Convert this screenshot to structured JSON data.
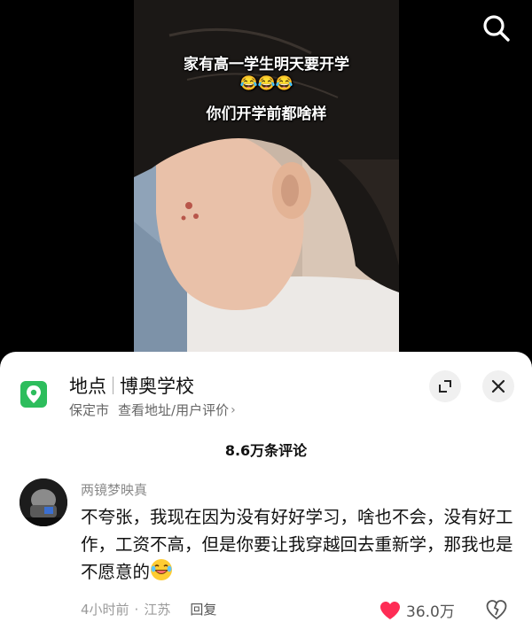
{
  "video": {
    "caption_line1": "家有高一学生明天要开学",
    "caption_line2": "😂😂😂",
    "caption_line3": "你们开学前都啥样"
  },
  "header": {
    "search_icon": "search-icon"
  },
  "location": {
    "label": "地点",
    "name": "博奥学校",
    "city": "保定市",
    "link": "查看地址/用户评价",
    "chevron": "›",
    "icon": "location-pin-icon",
    "accent": "#2dbd5c"
  },
  "comments": {
    "count_text": "8.6万条评论",
    "items": [
      {
        "username": "两镜梦映真",
        "text": "不夸张，我现在因为没有好好学习，啥也不会，没有好工作，工资不高，但是你要让我穿越回去重新学，那我也是不愿意的",
        "emoji": "rolling-laugh-emoji",
        "time": "4小时前",
        "dot": "·",
        "region": "江苏",
        "reply_label": "回复",
        "likes": "36.0万",
        "like_color": "#fe2c55"
      }
    ]
  }
}
